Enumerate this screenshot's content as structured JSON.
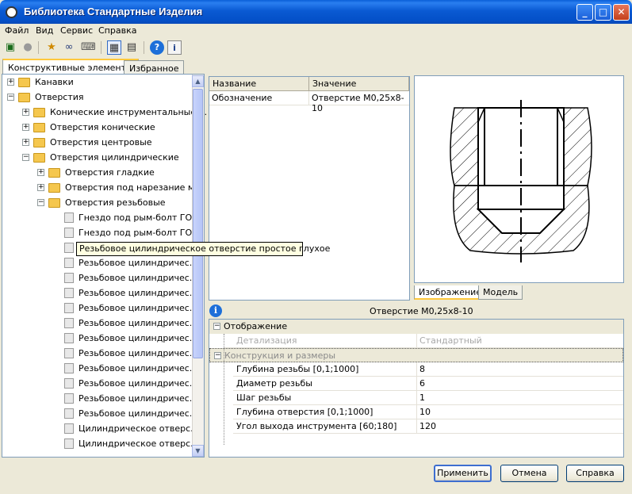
{
  "window": {
    "title": "Библиотека Стандартные Изделия"
  },
  "menu": [
    "Файл",
    "Вид",
    "Сервис",
    "Справка"
  ],
  "tabs": {
    "constructive": "Конструктивные элементы",
    "favorites": "Избранное"
  },
  "tree": [
    {
      "label": "Канавки",
      "level": 0,
      "expand": "+",
      "icon": "folder"
    },
    {
      "label": "Отверстия",
      "level": 0,
      "expand": "-",
      "icon": "folder"
    },
    {
      "label": "Конические инструментальные ...",
      "level": 1,
      "expand": "+",
      "icon": "folder"
    },
    {
      "label": "Отверстия конические",
      "level": 1,
      "expand": "+",
      "icon": "folder"
    },
    {
      "label": "Отверстия центровые",
      "level": 1,
      "expand": "+",
      "icon": "folder"
    },
    {
      "label": "Отверстия цилиндрические",
      "level": 1,
      "expand": "-",
      "icon": "folder"
    },
    {
      "label": "Отверстия гладкие",
      "level": 2,
      "expand": "+",
      "icon": "folder"
    },
    {
      "label": "Отверстия под нарезание м...",
      "level": 2,
      "expand": "+",
      "icon": "folder"
    },
    {
      "label": "Отверстия резьбовые",
      "level": 2,
      "expand": "-",
      "icon": "folder"
    },
    {
      "label": "Гнездо под рым-болт ГО...",
      "level": 3,
      "icon": "leaf"
    },
    {
      "label": "Гнездо под рым-болт ГО...",
      "level": 3,
      "icon": "leaf"
    },
    {
      "label": "",
      "level": 3,
      "icon": "leaf"
    },
    {
      "label": "Резьбовое цилиндричес...",
      "level": 3,
      "icon": "leaf"
    },
    {
      "label": "Резьбовое цилиндричес...",
      "level": 3,
      "icon": "leaf"
    },
    {
      "label": "Резьбовое цилиндричес...",
      "level": 3,
      "icon": "leaf"
    },
    {
      "label": "Резьбовое цилиндричес...",
      "level": 3,
      "icon": "leaf"
    },
    {
      "label": "Резьбовое цилиндричес...",
      "level": 3,
      "icon": "leaf"
    },
    {
      "label": "Резьбовое цилиндричес...",
      "level": 3,
      "icon": "leaf"
    },
    {
      "label": "Резьбовое цилиндричес...",
      "level": 3,
      "icon": "leaf"
    },
    {
      "label": "Резьбовое цилиндричес...",
      "level": 3,
      "icon": "leaf"
    },
    {
      "label": "Резьбовое цилиндричес...",
      "level": 3,
      "icon": "leaf"
    },
    {
      "label": "Резьбовое цилиндричес...",
      "level": 3,
      "icon": "leaf"
    },
    {
      "label": "Резьбовое цилиндричес...",
      "level": 3,
      "icon": "leaf"
    },
    {
      "label": "Цилиндрическое отверс...",
      "level": 3,
      "icon": "leaf"
    },
    {
      "label": "Цилиндрическое отверс...",
      "level": 3,
      "icon": "leaf"
    }
  ],
  "tooltip": "Резьбовое цилиндрическое отверстие простое глухое",
  "param_table": {
    "headers": [
      "Название",
      "Значение"
    ],
    "rows": [
      [
        "Обозначение",
        "Отверстие M0,25x8-10"
      ]
    ]
  },
  "image_tabs": {
    "image": "Изображение",
    "model": "Модель"
  },
  "info_text": "Отверстие M0,25x8-10",
  "property_grid": {
    "group_display": "Отображение",
    "detail_name": "Детализация",
    "detail_value": "Стандартный",
    "group_construct": "Конструкция и размеры",
    "rows": [
      [
        "Глубина резьбы [0,1;1000]",
        "8"
      ],
      [
        "Диаметр резьбы",
        "6"
      ],
      [
        "Шаг резьбы",
        "1"
      ],
      [
        "Глубина отверстия [0,1;1000]",
        "10"
      ],
      [
        "Угол выхода инструмента [60;180]",
        "120"
      ]
    ]
  },
  "buttons": {
    "apply": "Применить",
    "cancel": "Отмена",
    "help": "Справка"
  }
}
